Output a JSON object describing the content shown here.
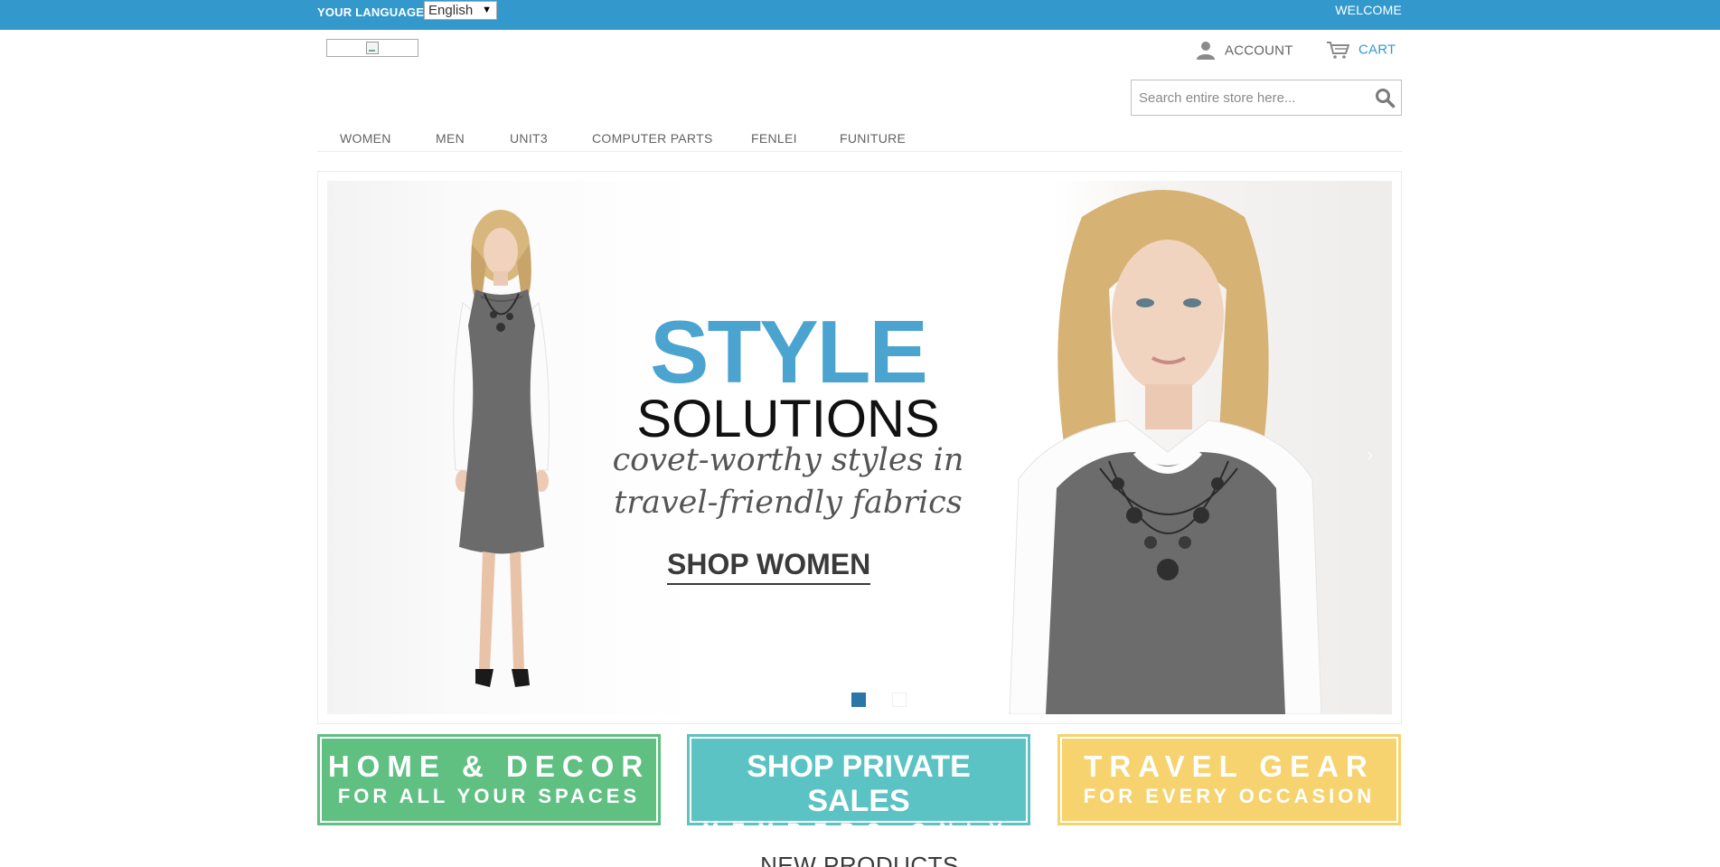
{
  "topbar": {
    "language_label": "YOUR LANGUAGE:",
    "language_selected": "English",
    "welcome": "WELCOME"
  },
  "header": {
    "account_label": "ACCOUNT",
    "cart_label": "CART",
    "search_placeholder": "Search entire store here..."
  },
  "nav": {
    "items": [
      "WOMEN",
      "MEN",
      "UNIT3",
      "COMPUTER PARTS",
      "FENLEI",
      "FUNITURE"
    ]
  },
  "slider": {
    "title": "STYLE",
    "subtitle": "SOLUTIONS",
    "tagline_1": "covet-worthy styles in",
    "tagline_2": "travel-friendly fabrics",
    "cta": "SHOP WOMEN",
    "slide_count": 2,
    "active_slide": 1
  },
  "promos": [
    {
      "line1": "HOME & DECOR",
      "line2": "FOR ALL YOUR SPACES",
      "color": "#5fc082"
    },
    {
      "line1": "SHOP PRIVATE SALES",
      "line2": "MEMBERS ONLY",
      "color": "#5bc3c4"
    },
    {
      "line1": "TRAVEL GEAR",
      "line2": "FOR EVERY OCCASION",
      "color": "#f6d36e"
    }
  ],
  "sections": {
    "new_products": "NEW PRODUCTS"
  },
  "colors": {
    "brand_blue": "#3399cc",
    "dot_active": "#2b76a8",
    "style_blue": "#4ba3d0"
  }
}
